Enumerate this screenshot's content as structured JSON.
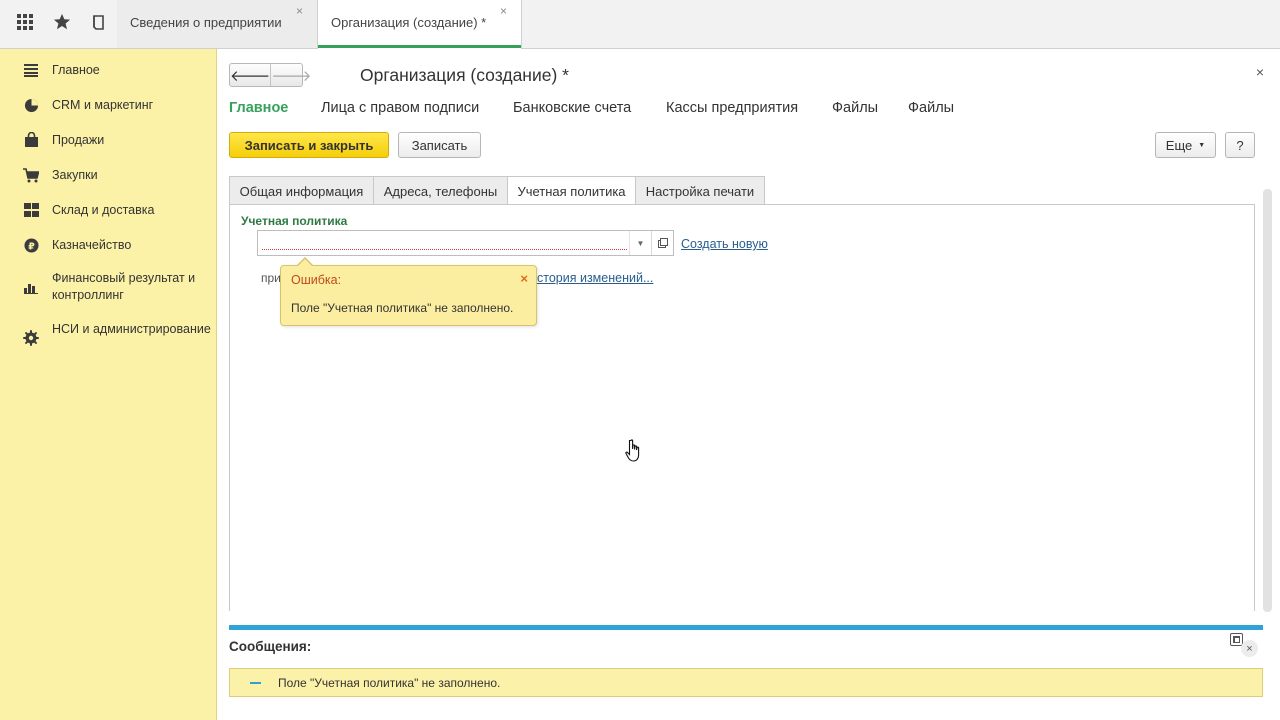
{
  "topbar": {
    "icons": [
      "apps-grid-icon",
      "favorites-star-icon",
      "history-icon"
    ],
    "tabs": [
      {
        "label": "Сведения о предприятии",
        "close": "×"
      },
      {
        "label": "Организация (создание) *",
        "close": "×"
      }
    ]
  },
  "sidebar": {
    "items": [
      {
        "label": "Главное",
        "icon": "menu-lines-icon"
      },
      {
        "label": "CRM и маркетинг",
        "icon": "pie-chart-icon"
      },
      {
        "label": "Продажи",
        "icon": "shopping-bag-icon"
      },
      {
        "label": "Закупки",
        "icon": "cart-icon"
      },
      {
        "label": "Склад и доставка",
        "icon": "warehouse-grid-icon"
      },
      {
        "label": "Казначейство",
        "icon": "ruble-coin-icon"
      },
      {
        "label": "Финансовый результат и контроллинг",
        "icon": "bar-chart-icon"
      },
      {
        "label": "НСИ и администрирование",
        "icon": "gear-icon"
      }
    ]
  },
  "form": {
    "title": "Организация (создание) *",
    "close": "×",
    "nav": {
      "back": "🡐",
      "forward": "🡒"
    },
    "sections": [
      "Главное",
      "Лица с правом подписи",
      "Банковские счета",
      "Кассы предприятия",
      "Файлы",
      "Файлы"
    ],
    "buttons": {
      "save_close": "Записать и закрыть",
      "save": "Записать",
      "more": "Еще",
      "help": "?"
    },
    "tabs": [
      "Общая информация",
      "Адреса, телефоны",
      "Учетная политика",
      "Настройка печати"
    ],
    "policy": {
      "group_title": "Учетная политика",
      "value": "",
      "create_link": "Создать новую",
      "hint_prefix": "при",
      "history_link": "стория изменений..."
    }
  },
  "error_tooltip": {
    "title": "Ошибка:",
    "close": "×",
    "text": "Поле \"Учетная политика\" не заполнено."
  },
  "messages": {
    "title": "Сообщения:",
    "items": [
      "Поле \"Учетная политика\" не заполнено."
    ]
  },
  "colors": {
    "sidebar_bg": "#fbf2a8",
    "accent_green": "#36a15c",
    "primary_button": "#f5cf0a",
    "messages_line": "#2fa3d8",
    "tooltip_bg": "#fbeea0"
  }
}
